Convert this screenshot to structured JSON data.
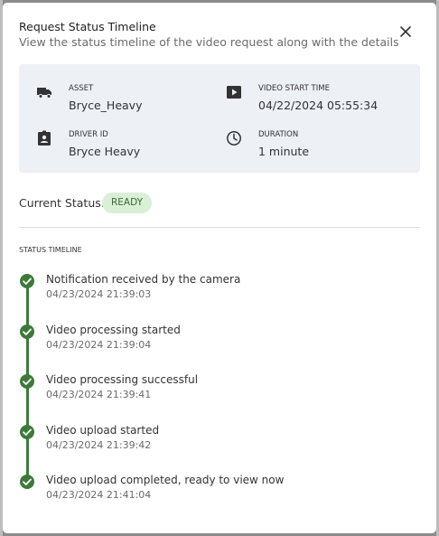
{
  "modal": {
    "title": "Request Status Timeline",
    "subtitle": "View the status timeline of the video request along with the details",
    "close_icon": "close-icon"
  },
  "details": {
    "asset": {
      "label": "ASSET",
      "value": "Bryce_Heavy",
      "icon": "truck-icon"
    },
    "video_start_time": {
      "label": "VIDEO START TIME",
      "value": "04/22/2024 05:55:34",
      "icon": "play-icon"
    },
    "driver_id": {
      "label": "DRIVER ID",
      "value": "Bryce Heavy",
      "icon": "id-badge-icon"
    },
    "duration": {
      "label": "DURATION",
      "value": "1 minute",
      "icon": "clock-icon"
    }
  },
  "status": {
    "label": "Current Status:",
    "value": "READY",
    "badge_bg": "#d9efd6",
    "badge_text_color": "#3a6b35"
  },
  "timeline": {
    "heading": "STATUS TIMELINE",
    "accent_color": "#3d7a3a",
    "items": [
      {
        "text": "Notification received by the camera",
        "time": "04/23/2024 21:39:03"
      },
      {
        "text": "Video processing started",
        "time": "04/23/2024 21:39:04"
      },
      {
        "text": "Video processing successful",
        "time": "04/23/2024 21:39:41"
      },
      {
        "text": "Video upload started",
        "time": "04/23/2024 21:39:42"
      },
      {
        "text": "Video upload completed, ready to view now",
        "time": "04/23/2024 21:41:04"
      }
    ]
  }
}
